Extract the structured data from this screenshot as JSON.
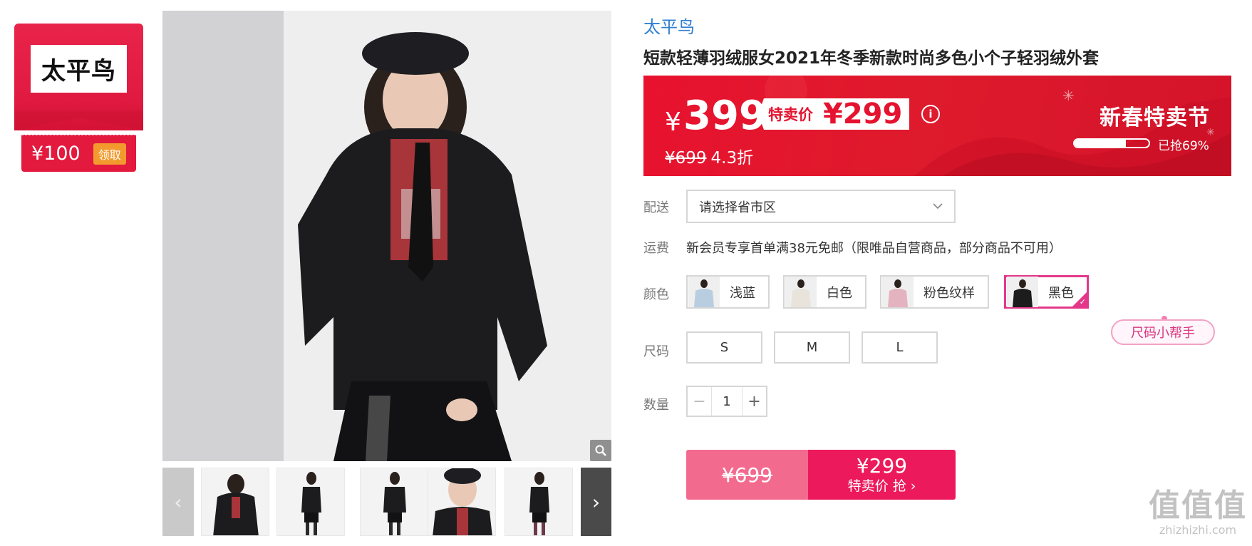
{
  "coupon": {
    "brand": "太平鸟",
    "amount": "¥100",
    "claim_label": "领取"
  },
  "product": {
    "brand_link": "太平鸟",
    "title": "短款轻薄羽绒服女2021年冬季新款时尚多色小个子轻羽绒外套"
  },
  "banner": {
    "currency": "¥",
    "price": "399",
    "special_label": "特卖价",
    "special_price": "¥299",
    "info_icon": "info-icon",
    "original_price": "¥699",
    "discount": "4.3折",
    "festival": "新春特卖节",
    "sold_fraction": 0.69,
    "sold_label": "已抢69%"
  },
  "delivery": {
    "label": "配送",
    "placeholder": "请选择省市区"
  },
  "shipping": {
    "label": "运费",
    "text": "新会员专享首单满38元免邮（限唯品自营商品，部分商品不可用）"
  },
  "colors": {
    "label": "颜色",
    "options": [
      {
        "name": "浅蓝",
        "swatch": "#b9cde0"
      },
      {
        "name": "白色",
        "swatch": "#e8e4dc"
      },
      {
        "name": "粉色纹样",
        "swatch": "#e4b3c0"
      },
      {
        "name": "黑色",
        "swatch": "#1c1c1c"
      }
    ],
    "selected": "黑色",
    "selected_color": "#e3388a"
  },
  "sizes": {
    "label": "尺码",
    "options": [
      "S",
      "M",
      "L"
    ],
    "helper": "尺码小帮手"
  },
  "quantity": {
    "label": "数量",
    "minus": "−",
    "value": "1",
    "plus": "+"
  },
  "buy": {
    "original": "¥699",
    "price": "¥299",
    "action": "特卖价 抢 ›"
  },
  "thumbs": {
    "prev": "‹",
    "next": "›"
  },
  "watermark": {
    "glyphs": "值值值",
    "url": "zhizhizhi.com"
  },
  "colors_theme": {
    "banner_red": "#e3132f",
    "buy_pink": "#ec1a5c",
    "link_blue": "#2f7fd0"
  }
}
